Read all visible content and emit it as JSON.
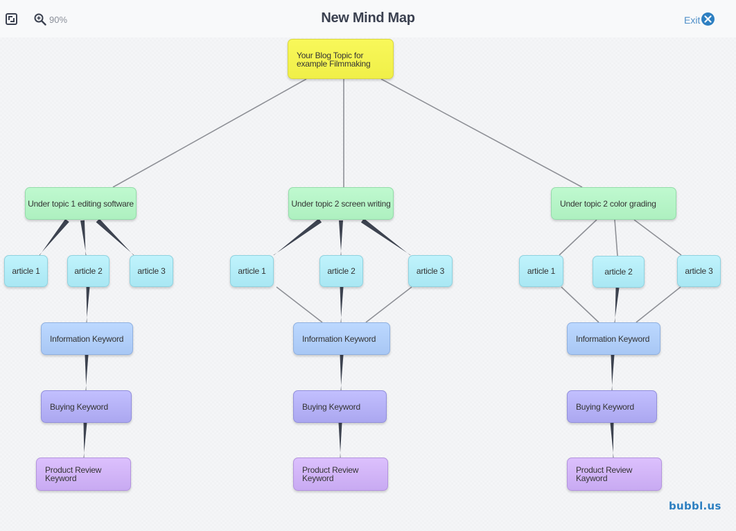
{
  "header": {
    "title": "New Mind Map",
    "zoom_level": "90%",
    "exit_label": "Exit",
    "icons": {
      "fit": "fit-screen-icon",
      "zoom": "zoom-in-icon",
      "exit": "close-circle-icon"
    }
  },
  "colors": {
    "root": "#f4f34f",
    "topic": "#b6f4c7",
    "article": "#b4edf7",
    "information": "#b2d0fa",
    "buying": "#b6b3f7",
    "review": "#d2b5f8",
    "edge": "#8e9096",
    "edge_tapered": "#3d4350",
    "accent": "#2d7fc1"
  },
  "mindmap": {
    "root": {
      "label": "Your Blog Topic for example Filmmaking"
    },
    "branches": [
      {
        "topic": "Under topic 1 editing software",
        "articles": [
          "article 1",
          "article 2",
          "article 3"
        ],
        "information": "Information Keyword",
        "buying": "Buying Keyword",
        "review": "Product Review Keyword"
      },
      {
        "topic": "Under topic 2 screen writing",
        "articles": [
          "article 1",
          "article 2",
          "article 3"
        ],
        "information": "Information Keyword",
        "buying": "Buying Keyword",
        "review": "Product Review Keyword"
      },
      {
        "topic": "Under topic 2 color grading",
        "articles": [
          "article 1",
          "article 2",
          "article 3"
        ],
        "information": "Information Keyword",
        "buying": "Buying Keyword",
        "review": "Product Review Kayword"
      }
    ]
  },
  "footer": {
    "brand": "bubbl.us"
  }
}
